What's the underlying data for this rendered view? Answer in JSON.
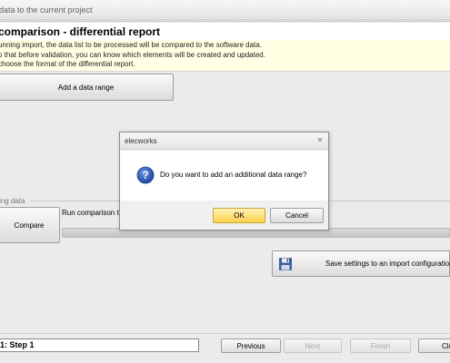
{
  "window": {
    "title": "data to the current project"
  },
  "header": {
    "title": "comparison - differential report",
    "description_lines": [
      "unning import, the data list to be processed will be compared to the software data.",
      "o that before validation, you can know which elements will be created and updated.",
      "choose the format of the differential report."
    ]
  },
  "buttons": {
    "add_range": "Add a data range",
    "compare": "Compare",
    "save_settings": "Save settings to an import configuration",
    "previous": "Previous",
    "next": "Next",
    "finish": "Finish",
    "close": "Clo"
  },
  "section": {
    "label": "ing data",
    "run_label": "Run comparison to i"
  },
  "progress": {
    "value": 0
  },
  "step": {
    "label": "1: Step 1"
  },
  "dialog": {
    "title": "elecworks",
    "close_glyph": "×",
    "message": "Do you want to add an additional data range?",
    "ok": "OK",
    "cancel": "Cancel"
  },
  "colors": {
    "description_bg": "#ffffe3",
    "ok_button": "#ffd04a",
    "question_icon": "#2e5db8"
  },
  "icons": {
    "save": "floppy-disk-icon",
    "question": "question-icon"
  }
}
